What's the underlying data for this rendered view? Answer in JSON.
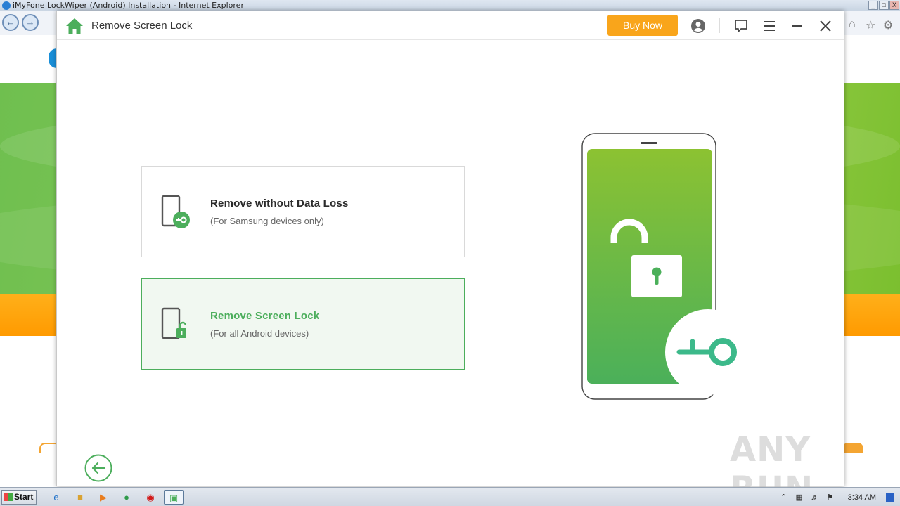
{
  "browser": {
    "title": "iMyFone LockWiper (Android) Installation - Internet Explorer",
    "controls": [
      "_",
      "□",
      "X"
    ]
  },
  "app": {
    "title": "Remove Screen Lock",
    "buy_now_label": "Buy Now",
    "options": [
      {
        "title": "Remove without Data Loss",
        "subtitle": "(For Samsung devices only)"
      },
      {
        "title": "Remove Screen Lock",
        "subtitle": "(For all Android devices)"
      }
    ],
    "accent_color": "#4cae5c",
    "buy_color": "#f9a51b"
  },
  "watermark": "ANY RUN",
  "taskbar": {
    "start_label": "Start",
    "clock": "3:34 AM"
  }
}
